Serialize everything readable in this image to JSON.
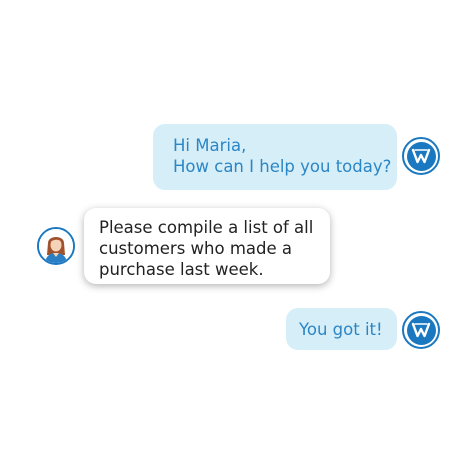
{
  "colors": {
    "bot_bubble_bg": "#d6eef8",
    "bot_text": "#2b86c5",
    "user_bubble_bg": "#ffffff",
    "user_text": "#222222",
    "brand_blue": "#1a78c0"
  },
  "messages": [
    {
      "sender": "bot",
      "avatar": "brand-logo-icon",
      "lines": [
        "Hi Maria,",
        "How can I help you today?"
      ]
    },
    {
      "sender": "user",
      "avatar": "user-avatar-maria",
      "lines": [
        "Please compile a list of all",
        "customers who made a",
        "purchase last week."
      ]
    },
    {
      "sender": "bot",
      "avatar": "brand-logo-icon",
      "lines": [
        "You got it!"
      ]
    }
  ]
}
